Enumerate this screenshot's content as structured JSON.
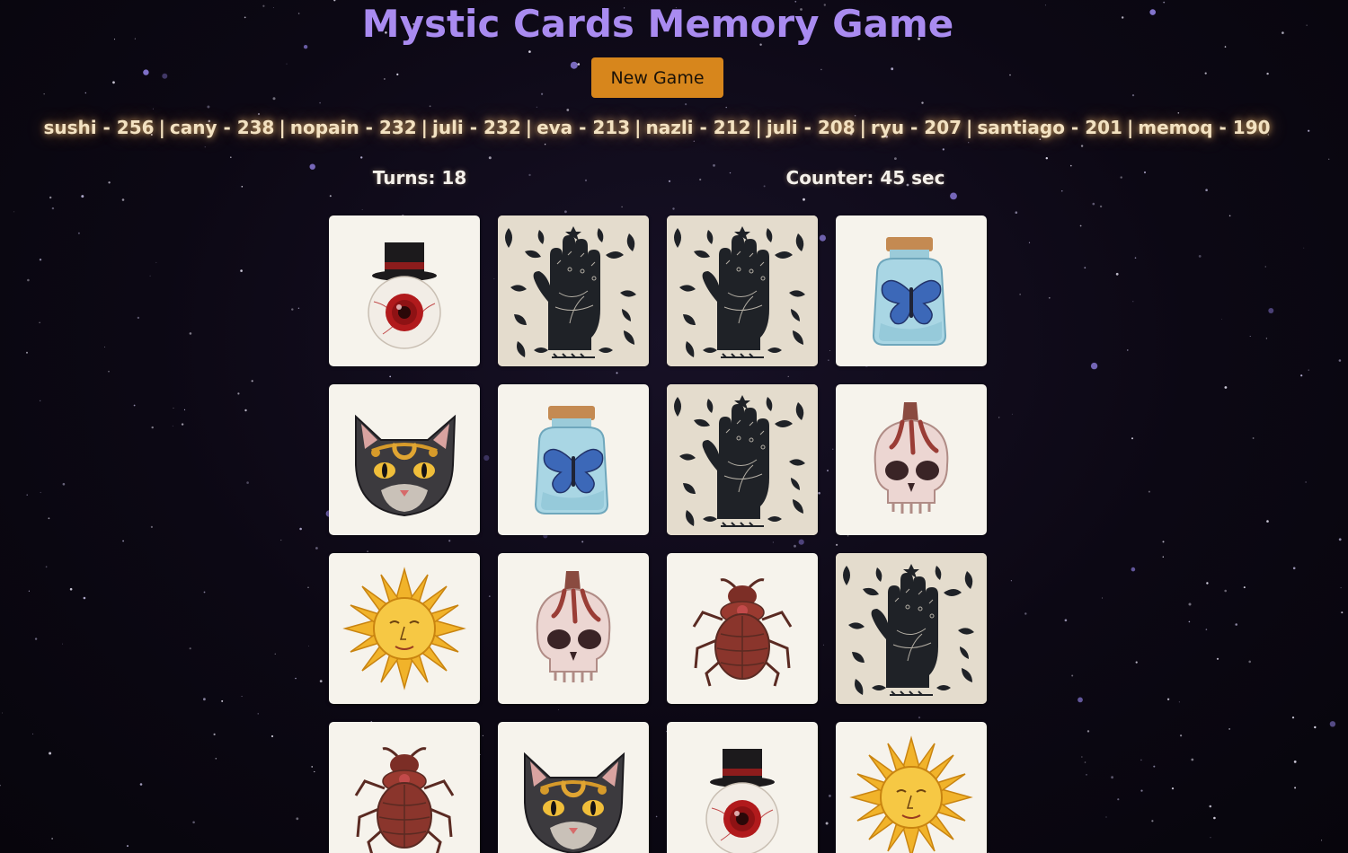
{
  "game": {
    "title": "Mystic Cards Memory Game",
    "new_game_label": "New Game",
    "turns_label": "Turns: 18",
    "counter_label": "Counter: 45 sec"
  },
  "leaderboard": [
    {
      "name": "sushi",
      "score": 256
    },
    {
      "name": "cany",
      "score": 238
    },
    {
      "name": "nopain",
      "score": 232
    },
    {
      "name": "juli",
      "score": 232
    },
    {
      "name": "eva",
      "score": 213
    },
    {
      "name": "nazli",
      "score": 212
    },
    {
      "name": "juli",
      "score": 208
    },
    {
      "name": "ryu",
      "score": 207
    },
    {
      "name": "santiago",
      "score": 201
    },
    {
      "name": "memoq",
      "score": 190
    }
  ],
  "board": {
    "columns": 4,
    "cards": [
      {
        "symbol": "eye-top-hat",
        "state": "flipped"
      },
      {
        "symbol": "palm-hand-back",
        "state": "hidden"
      },
      {
        "symbol": "palm-hand-back",
        "state": "hidden"
      },
      {
        "symbol": "butterfly-jar",
        "state": "flipped"
      },
      {
        "symbol": "black-cat",
        "state": "flipped"
      },
      {
        "symbol": "butterfly-jar",
        "state": "flipped"
      },
      {
        "symbol": "palm-hand-back",
        "state": "hidden"
      },
      {
        "symbol": "skull-candle",
        "state": "flipped"
      },
      {
        "symbol": "sun-face",
        "state": "flipped"
      },
      {
        "symbol": "skull-candle",
        "state": "flipped"
      },
      {
        "symbol": "scarab-beetle",
        "state": "flipped"
      },
      {
        "symbol": "palm-hand-back",
        "state": "hidden"
      },
      {
        "symbol": "scarab-beetle",
        "state": "flipped"
      },
      {
        "symbol": "black-cat",
        "state": "flipped"
      },
      {
        "symbol": "eye-top-hat",
        "state": "flipped"
      },
      {
        "symbol": "sun-face",
        "state": "flipped"
      }
    ]
  },
  "colors": {
    "title": "#a98bf0",
    "button": "#d7861c",
    "leaderboard_text": "#f3e2c2",
    "card_face": "#f6f3ec",
    "card_back": "#e4dccd",
    "background": "#0d0916"
  }
}
